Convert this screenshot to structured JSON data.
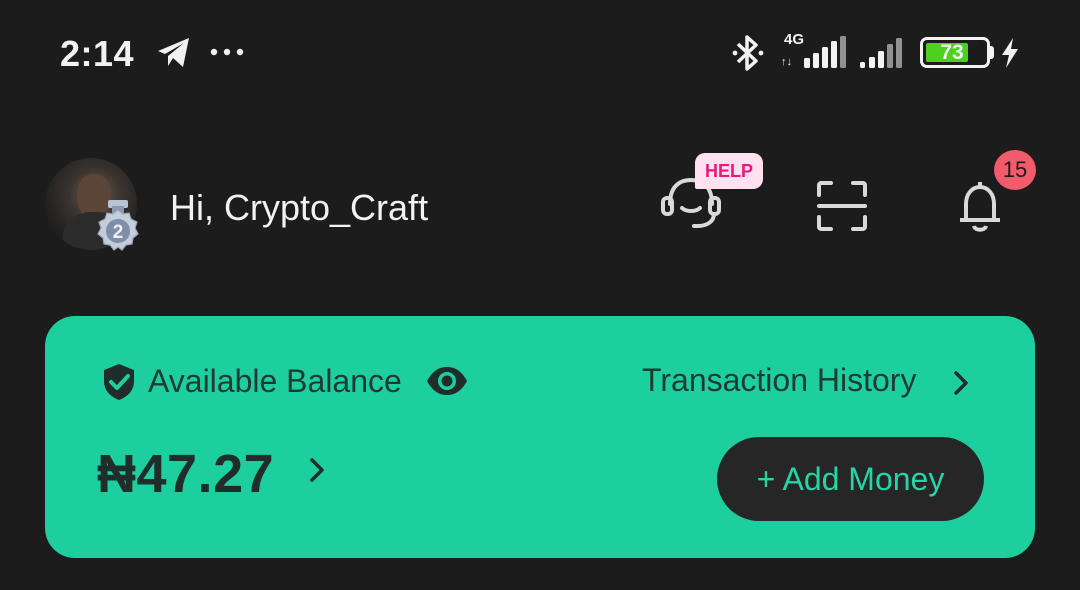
{
  "status_bar": {
    "time": "2:14",
    "network_type": "4G",
    "network_arrows": "↑↓",
    "battery_percent": "73",
    "battery_level": 0.73,
    "icons": [
      "telegram-icon",
      "more-dots-icon",
      "bluetooth-icon",
      "signal-icon",
      "signal-icon",
      "battery-icon",
      "charging-icon"
    ]
  },
  "header": {
    "greeting": "Hi, Crypto_Craft",
    "rank_level": "2",
    "help_badge": "HELP",
    "notification_count": "15"
  },
  "balance_card": {
    "label": "Available Balance",
    "amount": "₦47.27",
    "history_link": "Transaction History",
    "add_money": "+ Add Money"
  },
  "colors": {
    "background": "#1c1c1c",
    "card": "#1dcf9f",
    "card_text": "#1e3a33",
    "button_bg": "#262626",
    "button_text": "#22d6a5",
    "help_badge_bg": "#ffe0ef",
    "help_badge_text": "#e8197c",
    "notif_badge": "#f25b6b",
    "battery": "#4cd11f"
  }
}
